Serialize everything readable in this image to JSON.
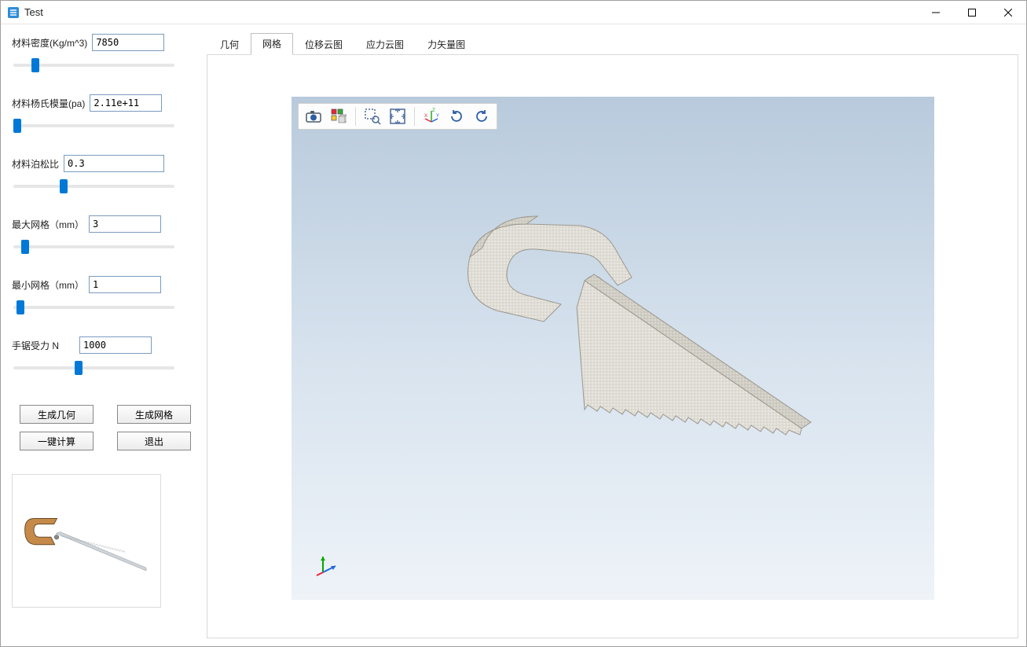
{
  "window": {
    "title": "Test"
  },
  "params": {
    "density": {
      "label": "材料密度(Kg/m^3)",
      "value": "7850",
      "slider": 12
    },
    "young": {
      "label": "材料杨氏模量(pa)",
      "value": "2.11e+11",
      "slider": 0
    },
    "poisson": {
      "label": "材料泊松比",
      "value": "0.3",
      "slider": 30
    },
    "maxMesh": {
      "label": "最大网格（mm）",
      "value": "3",
      "slider": 5
    },
    "minMesh": {
      "label": "最小网格（mm）",
      "value": "1",
      "slider": 2
    },
    "force": {
      "label": "手锯受力 N",
      "value": "1000",
      "slider": 40
    }
  },
  "buttons": {
    "genGeom": "生成几何",
    "genMesh": "生成网格",
    "compute": "一键计算",
    "exit": "退出"
  },
  "tabs": {
    "items": [
      {
        "id": "geom",
        "label": "几何"
      },
      {
        "id": "mesh",
        "label": "网格"
      },
      {
        "id": "disp",
        "label": "位移云图"
      },
      {
        "id": "stress",
        "label": "应力云图"
      },
      {
        "id": "force",
        "label": "力矢量图"
      }
    ],
    "active": "mesh"
  },
  "viewportToolbar": {
    "items": [
      {
        "id": "camera-icon"
      },
      {
        "id": "multi-view-icon"
      },
      {
        "sep": true
      },
      {
        "id": "zoom-area-icon"
      },
      {
        "id": "fit-view-icon"
      },
      {
        "sep": true
      },
      {
        "id": "axis-icon"
      },
      {
        "id": "rotate-cw-icon"
      },
      {
        "id": "rotate-ccw-icon"
      }
    ]
  },
  "colors": {
    "accent": "#0078d7",
    "canvasTop": "#b8cadc",
    "canvasBottom": "#eef3f8",
    "inputBorder": "#7a9bbf"
  }
}
